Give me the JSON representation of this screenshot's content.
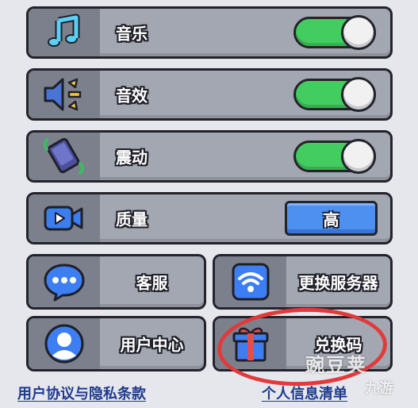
{
  "settings": {
    "music": {
      "label": "音乐",
      "icon": "music-note-icon",
      "enabled": true
    },
    "sound": {
      "label": "音效",
      "icon": "speaker-icon",
      "enabled": true
    },
    "vibration": {
      "label": "震动",
      "icon": "vibrate-phone-icon",
      "enabled": true
    },
    "quality": {
      "label": "质量",
      "icon": "video-camera-icon",
      "value": "高"
    }
  },
  "buttons": {
    "customer_service": {
      "label": "客服",
      "icon": "chat-bubble-icon"
    },
    "change_server": {
      "label": "更换服务器",
      "icon": "wifi-icon"
    },
    "user_center": {
      "label": "用户中心",
      "icon": "user-avatar-icon"
    },
    "redeem_code": {
      "label": "兑换码",
      "icon": "gift-box-icon"
    }
  },
  "footer": {
    "privacy": "用户协议与隐私条款",
    "personal_info": "个人信息清单"
  },
  "watermark": {
    "line1": "豌豆荚",
    "line2": "九游"
  },
  "colors": {
    "toggle_on": "#43cc5f",
    "quality_button": "#4e90f0",
    "highlight_circle": "#e23a3a",
    "link": "#1f3a8e"
  }
}
